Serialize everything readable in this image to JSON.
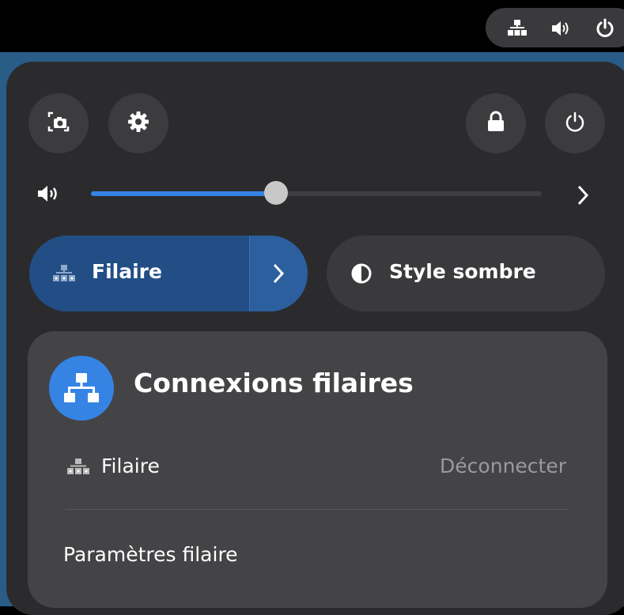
{
  "colors": {
    "accent": "#3584e4",
    "panel_bg": "#2b2b2e",
    "card_bg": "#444447",
    "desktop": "#2a5c88"
  },
  "tray_icons": [
    "network-wired-icon",
    "volume-icon",
    "power-icon"
  ],
  "top_buttons": {
    "screenshot": "screenshot-icon",
    "settings": "gear-icon",
    "lock": "lock-icon",
    "power": "power-icon"
  },
  "volume": {
    "level": 0.41,
    "icon": "volume-icon",
    "expand_icon": "chevron-right-icon"
  },
  "quick_settings": {
    "wired": {
      "label": "Filaire",
      "active": true
    },
    "dark_style": {
      "label": "Style sombre",
      "active": false
    }
  },
  "wired_menu": {
    "title": "Connexions filaires",
    "connection_label": "Filaire",
    "connection_action": "Déconnecter",
    "settings_label": "Paramètres filaire"
  }
}
